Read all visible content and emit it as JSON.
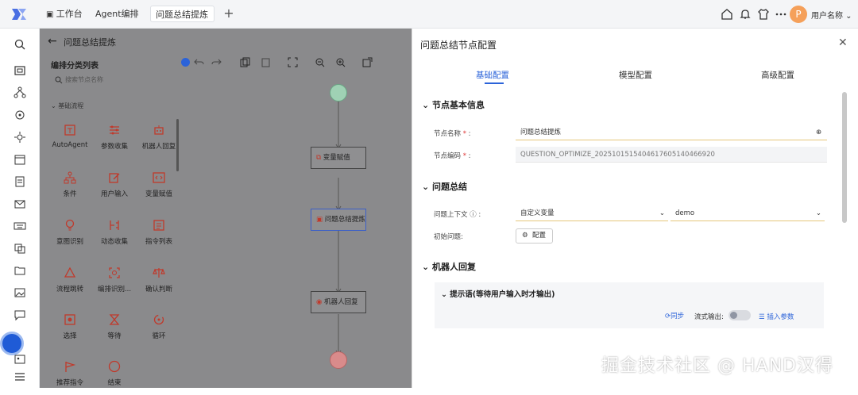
{
  "topbar": {
    "tabs": [
      {
        "label": "工作台",
        "active": false
      },
      {
        "label": "Agent编排",
        "active": false
      },
      {
        "label": "问题总结提炼",
        "active": true
      }
    ],
    "user": {
      "avatar_letter": "P",
      "name": "用户名称"
    }
  },
  "middle": {
    "title": "问题总结提炼",
    "panel_title": "编排分类列表",
    "search_placeholder": "搜索节点名称",
    "group": "基础流程",
    "nodes": [
      "AutoAgent",
      "参数收集",
      "机器人回复",
      "条件",
      "用户输入",
      "变量赋值",
      "意图识别",
      "动态收集",
      "指令列表",
      "流程跳转",
      "编排识别...",
      "确认判断",
      "选择",
      "等待",
      "循环",
      "推荐指令",
      "结束"
    ],
    "canvas_nodes": [
      "变量赋值",
      "问题总结提炼",
      "机器人回复"
    ]
  },
  "right": {
    "title": "问题总结节点配置",
    "tabs": [
      "基础配置",
      "模型配置",
      "高级配置"
    ],
    "section1": "节点基本信息",
    "name_label": "节点名称",
    "name_value": "问题总结提炼",
    "code_label": "节点编码",
    "code_value": "QUESTION_OPTIMIZE_20251015154046176051404669​20",
    "section2": "问题总结",
    "context_label": "问题上下文",
    "context_select1": "自定义变量",
    "context_select2": "demo",
    "init_label": "初始问题:",
    "config_btn": "配置",
    "section3": "机器人回复",
    "prompt_title": "提示语(等待用户输入时才输出)",
    "sync_label": "同步",
    "stream_label": "流式输出:",
    "insert_label": "插入参数"
  },
  "watermark": "掘金技术社区 @ HAND汉得",
  "colors": {
    "accent": "#2b63d9",
    "node_icon": "#c0392b",
    "start_node": "#9fd1b4",
    "end_node": "#d98b8b"
  }
}
